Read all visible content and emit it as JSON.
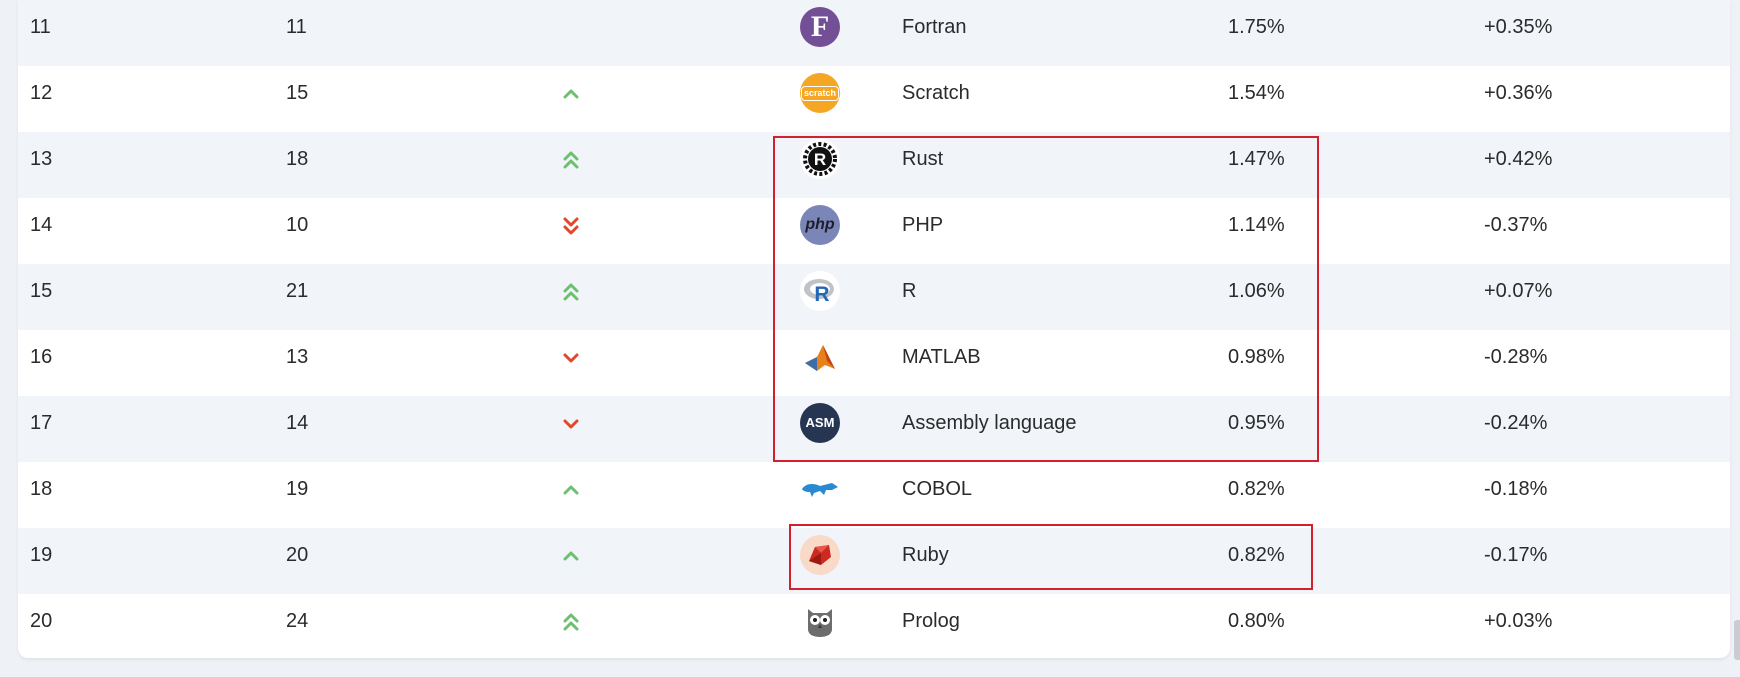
{
  "rows": [
    {
      "rank": "11",
      "prev": "11",
      "change": "none",
      "icon": "fortran-icon",
      "name": "Fortran",
      "pct": "1.75%",
      "delta": "+0.35%"
    },
    {
      "rank": "12",
      "prev": "15",
      "change": "up",
      "icon": "scratch-icon",
      "name": "Scratch",
      "pct": "1.54%",
      "delta": "+0.36%"
    },
    {
      "rank": "13",
      "prev": "18",
      "change": "double-up",
      "icon": "rust-icon",
      "name": "Rust",
      "pct": "1.47%",
      "delta": "+0.42%"
    },
    {
      "rank": "14",
      "prev": "10",
      "change": "double-down",
      "icon": "php-icon",
      "name": "PHP",
      "pct": "1.14%",
      "delta": "-0.37%"
    },
    {
      "rank": "15",
      "prev": "21",
      "change": "double-up",
      "icon": "r-icon",
      "name": "R",
      "pct": "1.06%",
      "delta": "+0.07%"
    },
    {
      "rank": "16",
      "prev": "13",
      "change": "down",
      "icon": "matlab-icon",
      "name": "MATLAB",
      "pct": "0.98%",
      "delta": "-0.28%"
    },
    {
      "rank": "17",
      "prev": "14",
      "change": "down",
      "icon": "asm-icon",
      "name": "Assembly language",
      "pct": "0.95%",
      "delta": "-0.24%"
    },
    {
      "rank": "18",
      "prev": "19",
      "change": "up",
      "icon": "cobol-icon",
      "name": "COBOL",
      "pct": "0.82%",
      "delta": "-0.18%"
    },
    {
      "rank": "19",
      "prev": "20",
      "change": "up",
      "icon": "ruby-icon",
      "name": "Ruby",
      "pct": "0.82%",
      "delta": "-0.17%"
    },
    {
      "rank": "20",
      "prev": "24",
      "change": "double-up",
      "icon": "prolog-icon",
      "name": "Prolog",
      "pct": "0.80%",
      "delta": "+0.03%"
    }
  ],
  "logos": {
    "fortran": "F",
    "php": "php",
    "r": "R",
    "asm": "ASM",
    "rust": "R",
    "scratch": "scratch"
  },
  "colors": {
    "up": "#6cc070",
    "down": "#e0482b",
    "highlight": "#d4202c",
    "alt_row": "#f1f5fa"
  }
}
